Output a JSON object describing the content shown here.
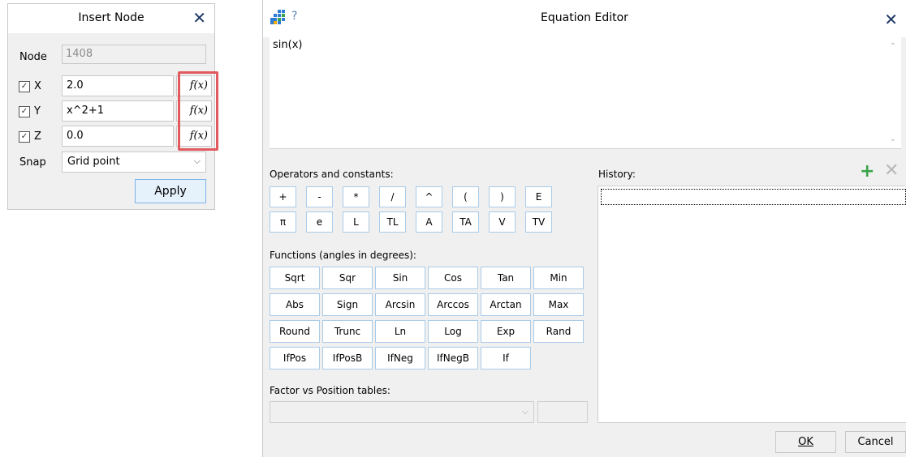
{
  "insert_node": {
    "title": "Insert Node",
    "close": "✕",
    "node_label": "Node",
    "node_value": "1408",
    "coords": [
      {
        "label": "X",
        "value": "2.0",
        "checked": true,
        "fx": "f(x)"
      },
      {
        "label": "Y",
        "value": "x^2+1",
        "checked": true,
        "fx": "f(x)"
      },
      {
        "label": "Z",
        "value": "0.0",
        "checked": true,
        "fx": "f(x)"
      }
    ],
    "snap_label": "Snap",
    "snap_value": "Grid point",
    "apply": "Apply",
    "highlight_color": "#e05a5f"
  },
  "equation_editor": {
    "title": "Equation Editor",
    "help": "?",
    "close": "✕",
    "expression": "sin(x)",
    "operators_label": "Operators and constants:",
    "operators_row1": [
      "+",
      "-",
      "*",
      "/",
      "^",
      "(",
      ")",
      "E"
    ],
    "operators_row2": [
      "π",
      "e",
      "L",
      "TL",
      "A",
      "TA",
      "V",
      "TV"
    ],
    "functions_label": "Functions (angles in degrees):",
    "functions": [
      [
        "Sqrt",
        "Sqr",
        "Sin",
        "Cos",
        "Tan",
        "Min"
      ],
      [
        "Abs",
        "Sign",
        "Arcsin",
        "Arccos",
        "Arctan",
        "Max"
      ],
      [
        "Round",
        "Trunc",
        "Ln",
        "Log",
        "Exp",
        "Rand"
      ],
      [
        "IfPos",
        "IfPosB",
        "IfNeg",
        "IfNegB",
        "If"
      ]
    ],
    "tables_label": "Factor vs Position tables:",
    "history_label": "History:",
    "ok": "OK",
    "cancel": "Cancel",
    "add_color": "#3aa34a"
  }
}
